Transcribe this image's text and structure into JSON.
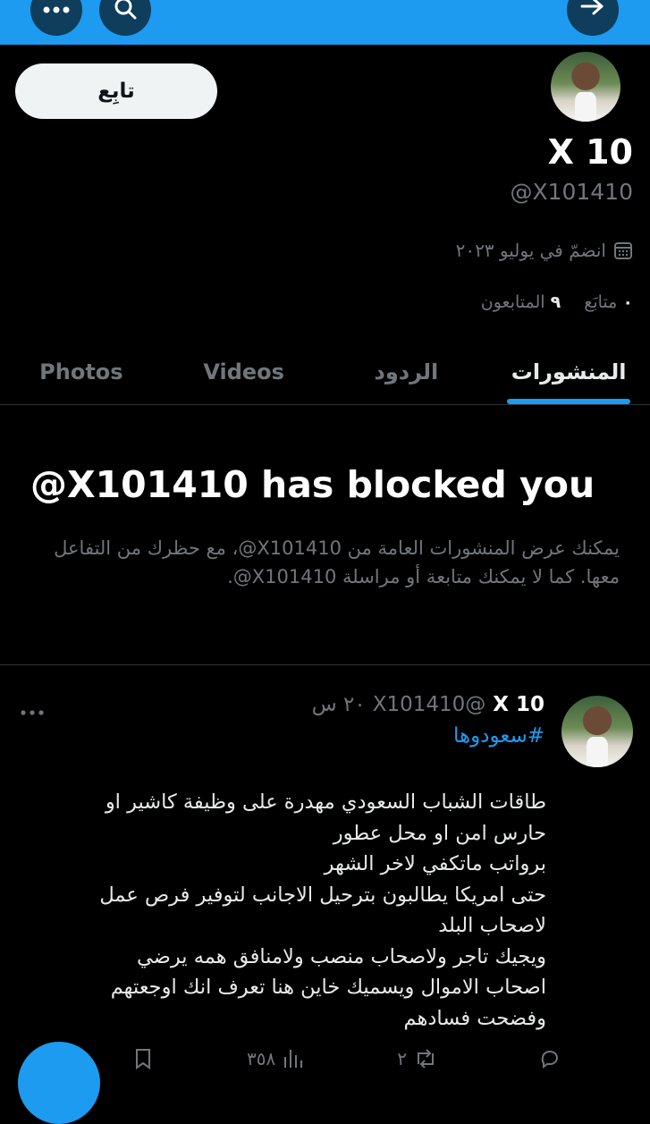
{
  "profile": {
    "follow_label": "تابِع",
    "name": "X 10",
    "handle": "@X101410",
    "joined": "انضمّ في يوليو ٢٠٢٣",
    "following_label": "متابَع",
    "following_count": "٠",
    "followers_label": "المتابعون",
    "followers_count": "٩"
  },
  "tabs": [
    "المنشورات",
    "الردود",
    "Videos",
    "Photos"
  ],
  "active_tab": "المنشورات",
  "blocked": {
    "title": "@X101410 has blocked you",
    "description": "يمكنك عرض المنشورات العامة من ‎@X101410‏، مع حظرك من التفاعل معها. كما لا يمكنك متابعة أو مراسلة ‎@X101410‏."
  },
  "post": {
    "name": "X 10",
    "handle": "@X101410",
    "time": "٢٠ س",
    "hashtag": "#سعودوها",
    "body": "طاقات الشباب السعودي مهدرة على وظيفة كاشير او\nحارس امن او محل عطور\nبرواتب ماتكفي لاخر الشهر\nحتى امريكا يطالبون بترحيل الاجانب لتوفير فرص عمل\nلاصحاب البلد\nويجيك تاجر ولاصحاب منصب ولامنافق همه يرضي\nاصحاب الاموال ويسميك خاين هنا تعرف انك اوجعتهم\nوفضحت فسادهم",
    "replies_count": "",
    "reposts_count": "٢",
    "views_count": "٣٥٨"
  },
  "colors": {
    "accent": "#1d9bf0",
    "background": "#000000",
    "muted": "#71767b"
  }
}
